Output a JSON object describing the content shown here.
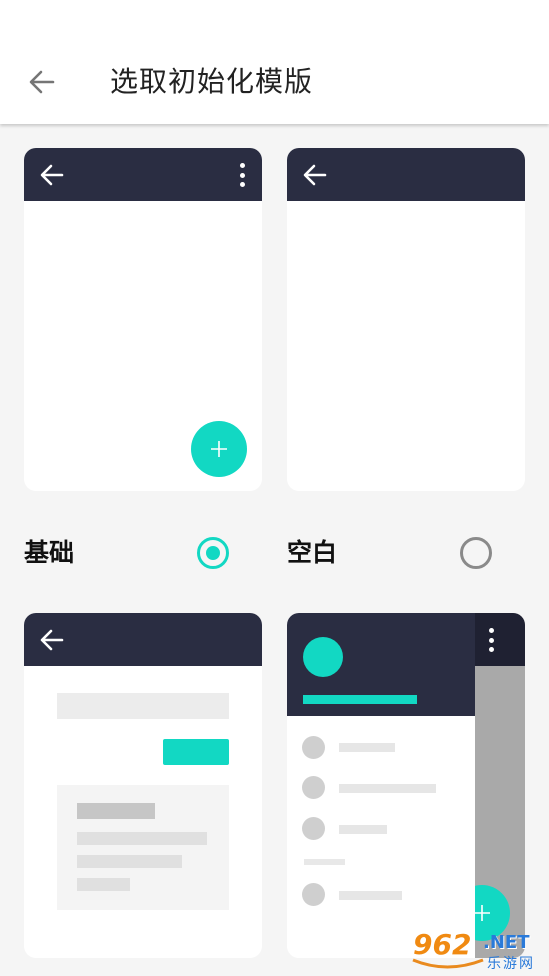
{
  "header": {
    "title": "选取初始化模版"
  },
  "templates": [
    {
      "label": "基础",
      "selected": true
    },
    {
      "label": "空白",
      "selected": false
    }
  ],
  "watermark": {
    "brand": "962",
    "tld": ".NET",
    "sub": "乐游网"
  },
  "colors": {
    "accent": "#12d8c3",
    "bar": "#2a2d42"
  }
}
